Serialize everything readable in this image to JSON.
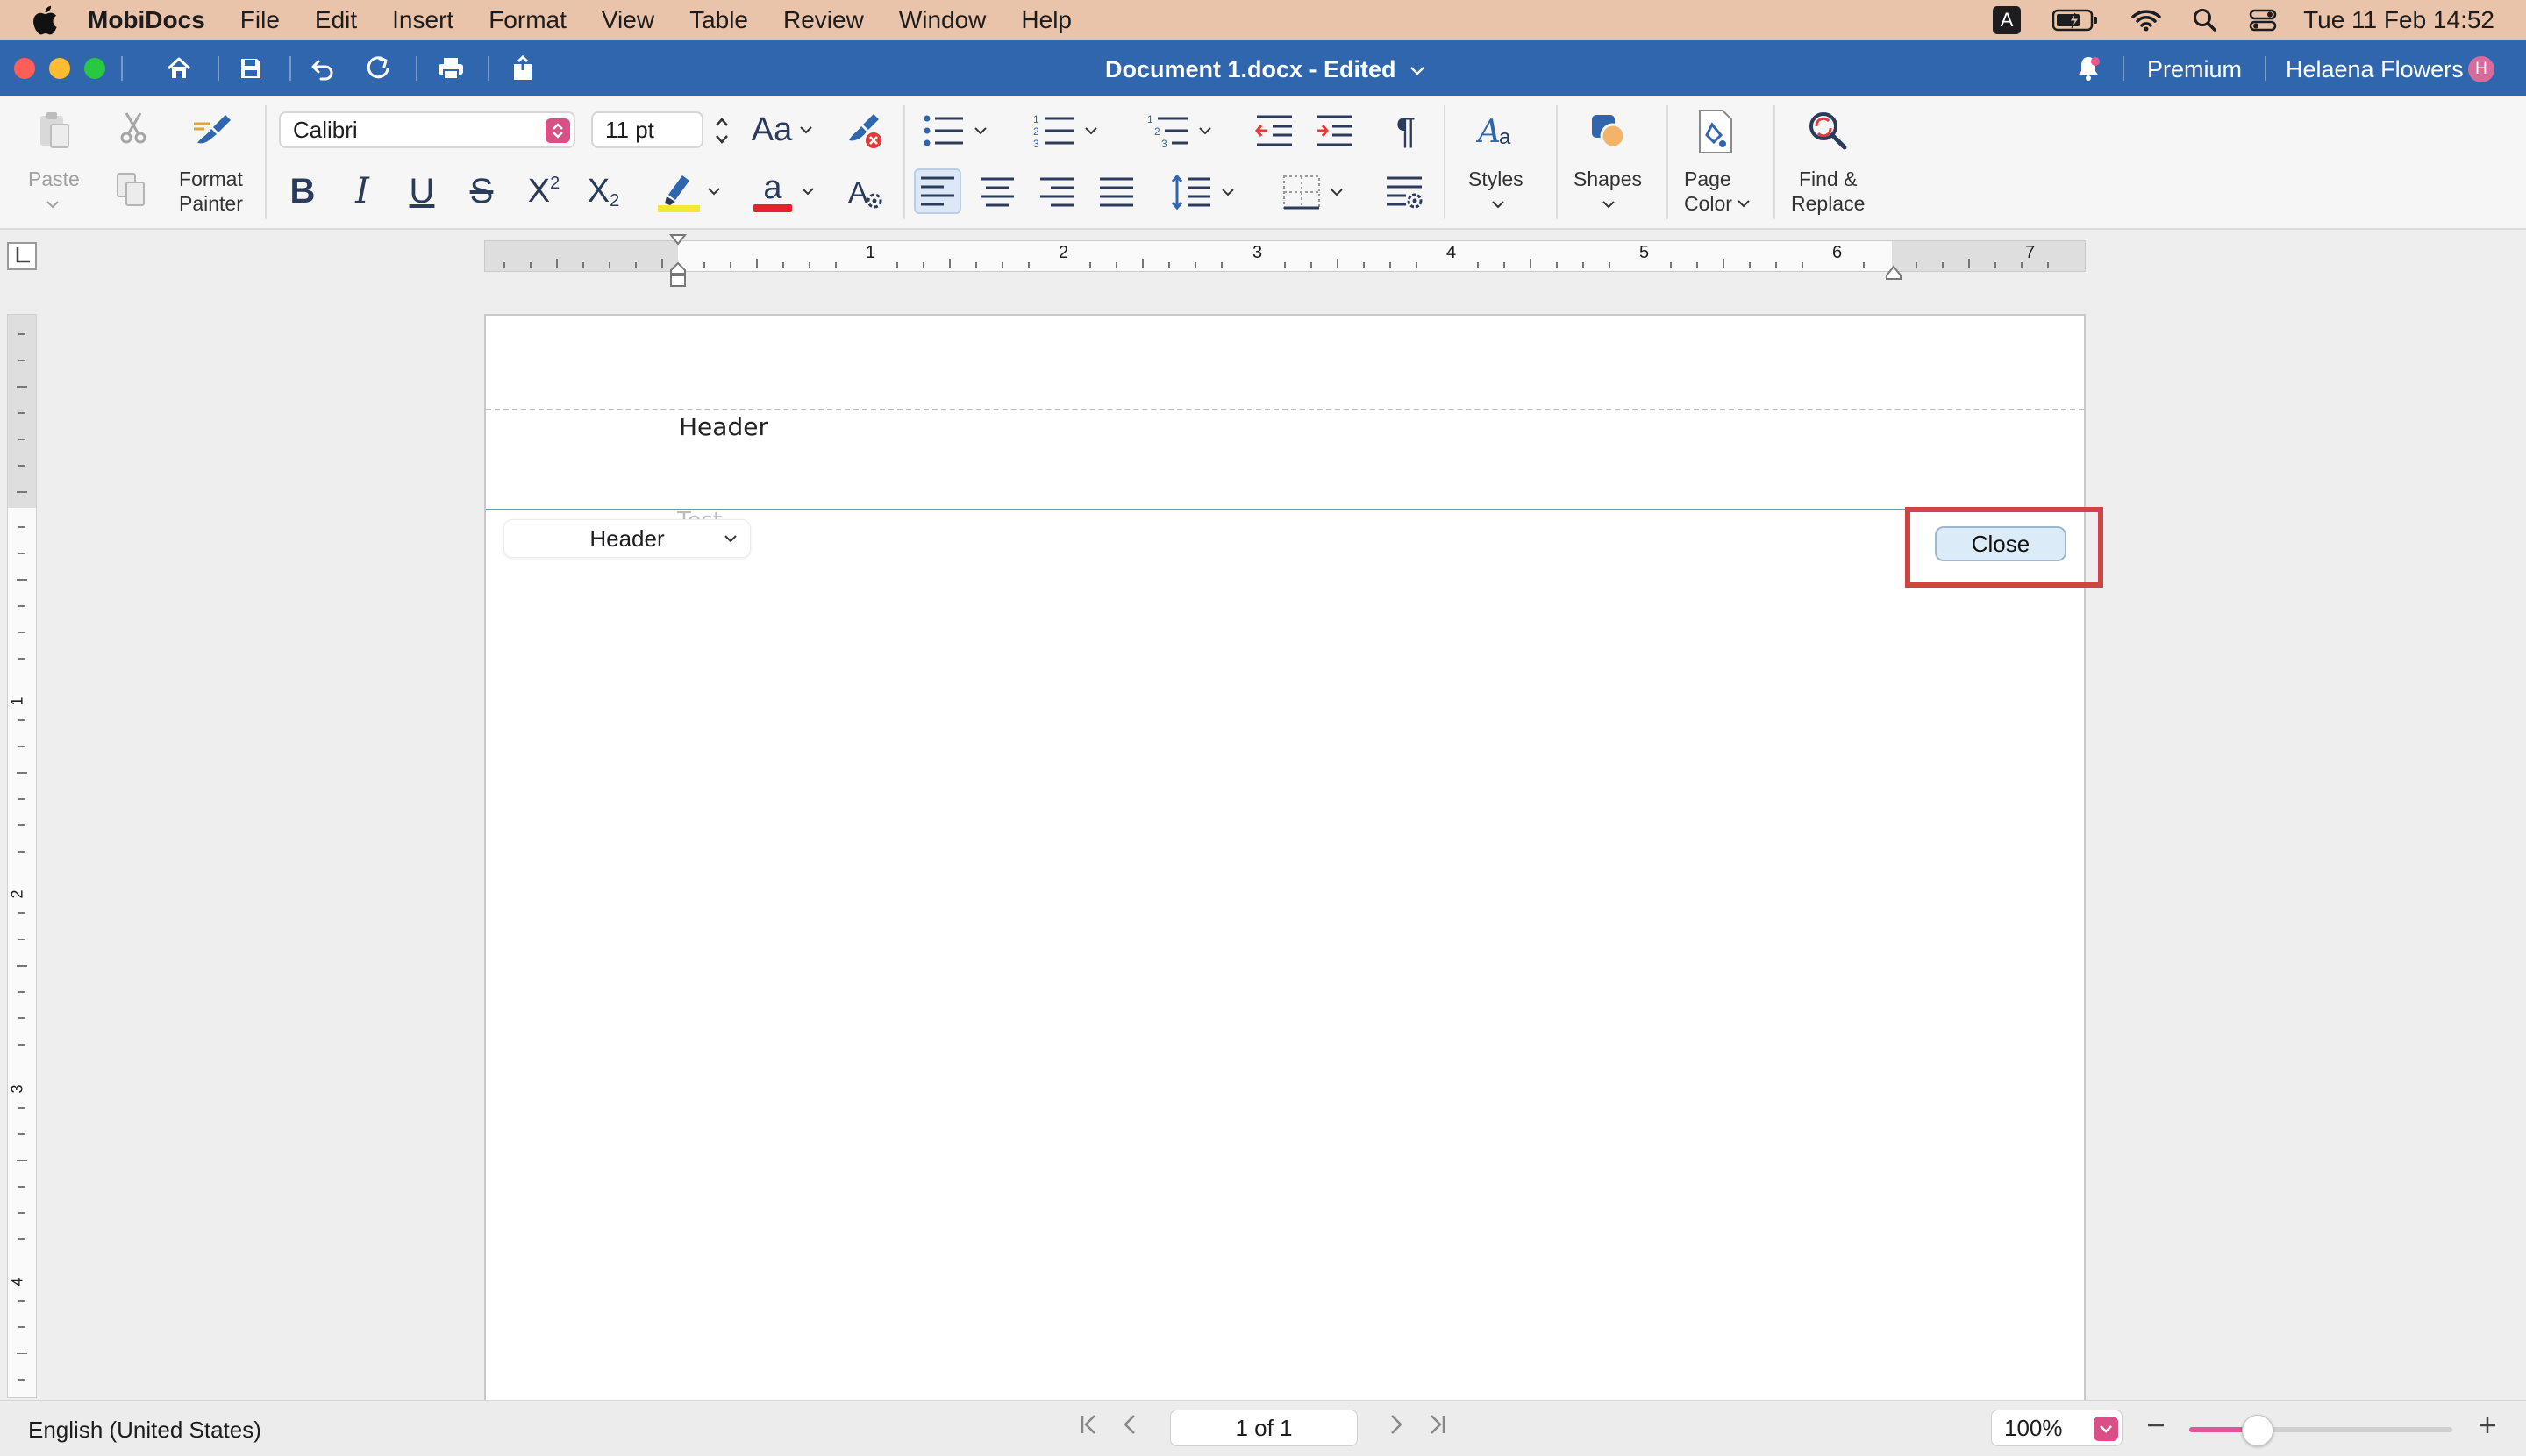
{
  "menubar": {
    "app_name": "MobiDocs",
    "items": [
      "File",
      "Edit",
      "Insert",
      "Format",
      "View",
      "Table",
      "Review",
      "Window",
      "Help"
    ],
    "input_indicator": "A",
    "clock": "Tue 11 Feb  14:52"
  },
  "titlebar": {
    "doc_title": "Document 1.docx - Edited",
    "premium": "Premium",
    "user_name": "Helaena Flowers",
    "avatar_initial": "H"
  },
  "ribbon": {
    "paste_label": "Paste",
    "format_painter_label": "Format\nPainter",
    "font_name": "Calibri",
    "font_size": "11 pt",
    "case_label": "Aa",
    "bold": "B",
    "italic": "I",
    "underline": "U",
    "strike": "S",
    "superscript": "X",
    "subscript": "X",
    "font_color_letter": "a",
    "pilcrow": "¶",
    "styles_label": "Styles",
    "shapes_label": "Shapes",
    "page_color_label": "Page\nColor",
    "find_replace_label": "Find &\nReplace"
  },
  "ruler": {
    "h_numbers": [
      "1",
      "2",
      "3",
      "4",
      "5",
      "6",
      "7"
    ],
    "v_numbers": [
      "1",
      "2",
      "3",
      "4"
    ]
  },
  "page": {
    "header_text": "Header",
    "ghost_text": "Test",
    "header_chip_label": "Header",
    "close_label": "Close"
  },
  "statusbar": {
    "language": "English (United States)",
    "page_indicator": "1 of 1",
    "zoom": "100%",
    "zoom_slider_fraction": 0.26
  },
  "colors": {
    "menubar_bg": "#e9c4aa",
    "titlebar_bg": "#2f66ad",
    "accent_pink": "#d94f86",
    "highlight_red": "#d24343",
    "header_divider": "#5fa3ad"
  }
}
